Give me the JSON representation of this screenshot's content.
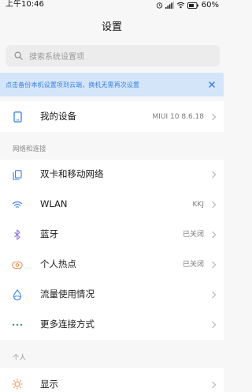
{
  "status_bar": {
    "time": "上午10:46",
    "battery": "60%",
    "icons": [
      "alarm-icon",
      "signal-icon",
      "wifi-icon",
      "battery-icon"
    ]
  },
  "title": "设置",
  "search": {
    "placeholder": "搜索系统设置项"
  },
  "banner": {
    "text": "点击备份本机设置项到云端，换机无需再次设置",
    "close": "×"
  },
  "my_device": {
    "label": "我的设备",
    "value": "MIUI 10 8.6.18"
  },
  "sections": {
    "network": {
      "header": "网络和连接",
      "items": [
        {
          "label": "双卡和移动网络",
          "value": "",
          "icon": "sim-card-icon"
        },
        {
          "label": "WLAN",
          "value": "KKJ",
          "icon": "wifi-icon"
        },
        {
          "label": "蓝牙",
          "value": "已关闭",
          "icon": "bluetooth-icon"
        },
        {
          "label": "个人热点",
          "value": "已关闭",
          "icon": "hotspot-icon"
        },
        {
          "label": "流量使用情况",
          "value": "",
          "icon": "data-usage-icon"
        },
        {
          "label": "更多连接方式",
          "value": "",
          "icon": "more-dots-icon"
        }
      ]
    },
    "personal": {
      "header": "个人",
      "items": [
        {
          "label": "显示",
          "value": "",
          "icon": "display-sun-icon"
        }
      ]
    }
  },
  "colors": {
    "accent_blue": "#3a82e0",
    "banner_bg": "#d4e5fa",
    "icon_orange": "#f08a4b",
    "icon_purple": "#8b6fe0"
  }
}
